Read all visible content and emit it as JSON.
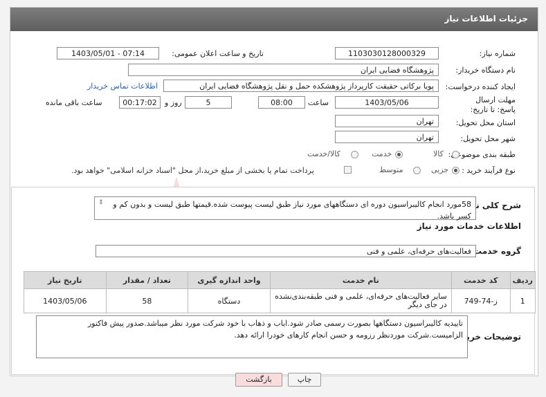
{
  "header": {
    "title": "جزئیات اطلاعات نیاز"
  },
  "fields": {
    "need_number_label": "شماره نیاز:",
    "need_number": "1103030128000329",
    "announce_label": "تاریخ و ساعت اعلان عمومی:",
    "announce_value": "1403/05/01 - 07:14",
    "buyer_org_label": "نام دستگاه خریدار:",
    "buyer_org": "پژوهشگاه فضایی ایران",
    "requester_label": "ایجاد کننده درخواست:",
    "requester": "پویا برکاتی حقیقت کارپرداز پژوهشکده حمل و نقل پژوهشگاه فضایی ایران",
    "contact_link": "اطلاعات تماس خریدار",
    "deadline_label": "مهلت ارسال پاسخ: تا تاریخ:",
    "deadline_date": "1403/05/06",
    "time_label": "ساعت",
    "deadline_time": "08:00",
    "days_value": "5",
    "days_label": "روز و",
    "remaining_time": "00:17:02",
    "remaining_label": "ساعت باقی مانده",
    "province_label": "استان محل تحویل:",
    "province": "تهران",
    "city_label": "شهر محل تحویل:",
    "city": "تهران",
    "category_label": "طبقه بندی موضوعی:",
    "category_options": [
      "کالا",
      "خدمت",
      "کالا/خدمت"
    ],
    "category_selected": "خدمت",
    "process_label": "نوع فرآیند خرید :",
    "process_options": [
      "جزیی",
      "متوسط"
    ],
    "process_selected": "جزیی",
    "treasury_note": "پرداخت تمام یا بخشی از مبلغ خرید،از محل \"اسناد خزانه اسلامی\" خواهد بود."
  },
  "description": {
    "label": "شرح کلی نیاز:",
    "text": "58مورد انجام کالیبراسیون دوره ای دستگاههای مورد نیاز طبق لیست پیوست شده.قیمتها طبق لیست و بدون کم و کسر باشد."
  },
  "services": {
    "section_title": "اطلاعات خدمات مورد نیاز",
    "group_label": "گروه خدمت:",
    "group_value": "فعالیت‌های حرفه‌ای، علمی و فنی",
    "columns": [
      "ردیف",
      "کد خدمت",
      "نام خدمت",
      "واحد اندازه گیری",
      "تعداد / مقدار",
      "تاریخ نیاز"
    ],
    "rows": [
      {
        "row": "1",
        "code": "ز-74-749",
        "name": "سایر فعالیت‌های حرفه‌ای، علمی و فنی طبقه‌بندی‌نشده در جای دیگر",
        "unit": "دستگاه",
        "qty": "58",
        "date": "1403/05/06"
      }
    ]
  },
  "buyer_notes": {
    "label": "توضیحات خریدار:",
    "text": "تاییدیه کالیبراسیون دستگاهها بصورت رسمی صادر شود.ایاب و ذهاب با خود شرکت مورد نظر میباشد.صدور پیش فاکتور الزامیست.شرکت موردنظر رزومه و حسن انجام کارهای خودرا ارائه دهد."
  },
  "buttons": {
    "print": "چاپ",
    "back": "بازگشت"
  },
  "colors": {
    "header_bg": "#6e6e6e",
    "link": "#2864b4",
    "back_button": "#f9dcdc"
  }
}
